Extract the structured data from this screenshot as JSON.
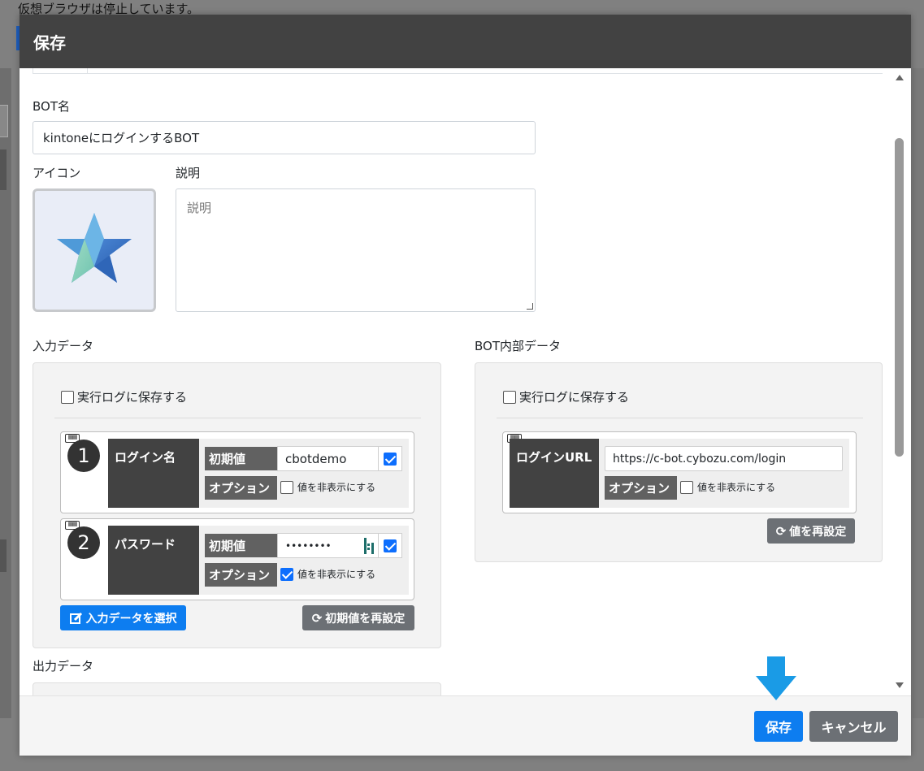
{
  "background": {
    "top_notice": "仮想ブラウザは停止しています。"
  },
  "modal": {
    "title": "保存",
    "bot_name": {
      "label": "BOT名",
      "value": "kintoneにログインするBOT"
    },
    "icon": {
      "label": "アイコン",
      "image": "star-icon"
    },
    "description": {
      "label": "説明",
      "placeholder": "説明"
    },
    "input_data": {
      "label": "入力データ",
      "save_log_label": "実行ログに保存する",
      "save_log_checked": false,
      "items": [
        {
          "number": "1",
          "name": "ログイン名",
          "initial_tag": "初期値",
          "initial_value": "cbotdemo",
          "initial_checked": true,
          "option_tag": "オプション",
          "hide_label": "値を非表示にする",
          "hide_checked": false
        },
        {
          "number": "2",
          "name": "パスワード",
          "initial_tag": "初期値",
          "initial_value": "••••••••",
          "initial_checked": true,
          "option_tag": "オプション",
          "hide_label": "値を非表示にする",
          "hide_checked": true
        }
      ],
      "select_button": "入力データを選択",
      "reset_button": "初期値を再設定"
    },
    "internal_data": {
      "label": "BOT内部データ",
      "save_log_label": "実行ログに保存する",
      "save_log_checked": false,
      "items": [
        {
          "name": "ログインURL",
          "value": "https://c-bot.cybozu.com/login",
          "option_tag": "オプション",
          "hide_label": "値を非表示にする",
          "hide_checked": false
        }
      ],
      "reset_button": "値を再設定"
    },
    "output_data": {
      "label": "出力データ"
    },
    "footer": {
      "save_button": "保存",
      "cancel_button": "キャンセル"
    }
  },
  "colors": {
    "header_bg": "#424242",
    "primary": "#0d7df0",
    "secondary": "#6c7075",
    "arrow": "#1a9be6"
  }
}
